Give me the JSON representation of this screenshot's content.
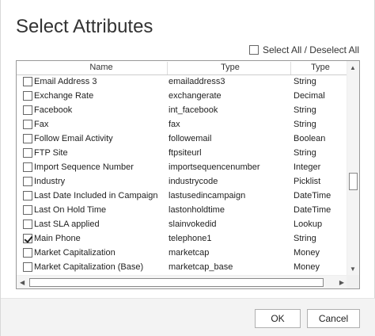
{
  "dialog": {
    "title": "Select Attributes",
    "select_all_label": "Select All / Deselect All"
  },
  "grid": {
    "headers": {
      "name": "Name",
      "type_value": "Type",
      "type_display": "Type"
    },
    "rows": [
      {
        "name": "Email Address 3",
        "value": "emailaddress3",
        "type": "String",
        "checked": false
      },
      {
        "name": "Exchange Rate",
        "value": "exchangerate",
        "type": "Decimal",
        "checked": false
      },
      {
        "name": "Facebook",
        "value": "int_facebook",
        "type": "String",
        "checked": false
      },
      {
        "name": "Fax",
        "value": "fax",
        "type": "String",
        "checked": false
      },
      {
        "name": "Follow Email Activity",
        "value": "followemail",
        "type": "Boolean",
        "checked": false
      },
      {
        "name": "FTP Site",
        "value": "ftpsiteurl",
        "type": "String",
        "checked": false
      },
      {
        "name": "Import Sequence Number",
        "value": "importsequencenumber",
        "type": "Integer",
        "checked": false
      },
      {
        "name": "Industry",
        "value": "industrycode",
        "type": "Picklist",
        "checked": false
      },
      {
        "name": "Last Date Included in Campaign",
        "value": "lastusedincampaign",
        "type": "DateTime",
        "checked": false
      },
      {
        "name": "Last On Hold Time",
        "value": "lastonholdtime",
        "type": "DateTime",
        "checked": false
      },
      {
        "name": "Last SLA applied",
        "value": "slainvokedid",
        "type": "Lookup",
        "checked": false
      },
      {
        "name": "Main Phone",
        "value": "telephone1",
        "type": "String",
        "checked": true
      },
      {
        "name": "Market Capitalization",
        "value": "marketcap",
        "type": "Money",
        "checked": false
      },
      {
        "name": "Market Capitalization (Base)",
        "value": "marketcap_base",
        "type": "Money",
        "checked": false
      }
    ]
  },
  "buttons": {
    "ok": "OK",
    "cancel": "Cancel"
  },
  "icons": {
    "scroll_up": "▲",
    "scroll_down": "▼",
    "scroll_left": "◀",
    "scroll_right": "▶"
  }
}
